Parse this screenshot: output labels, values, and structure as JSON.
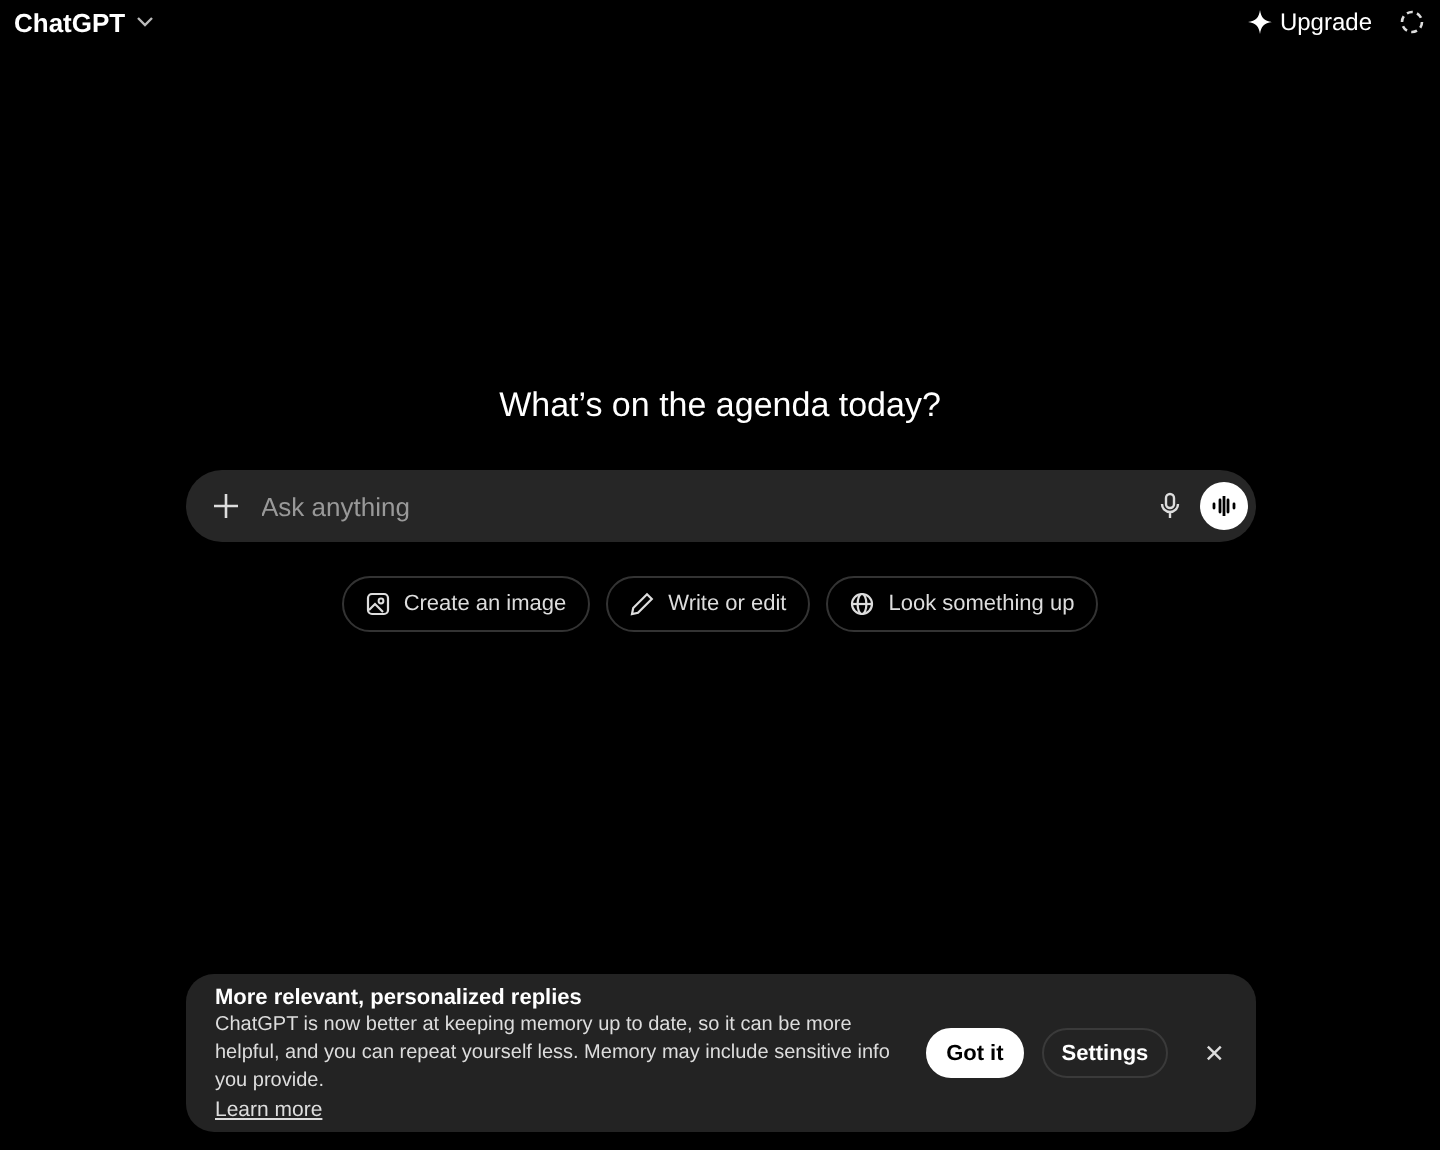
{
  "header": {
    "title": "ChatGPT",
    "upgrade": "Upgrade"
  },
  "heading": "What’s on the agenda today?",
  "composer": {
    "placeholder": "Ask anything"
  },
  "suggestions": [
    {
      "kind": "image",
      "label": "Create an image"
    },
    {
      "kind": "edit",
      "label": "Write or edit"
    },
    {
      "kind": "search",
      "label": "Look something up"
    }
  ],
  "banner": {
    "title": "More relevant, personalized replies",
    "message": "ChatGPT is now better at keeping memory up to date, so it can be more helpful, and you can repeat yourself less. Memory may include sensitive info you provide.",
    "link": "Learn more",
    "buttons": [
      "Got it",
      "Settings"
    ]
  }
}
